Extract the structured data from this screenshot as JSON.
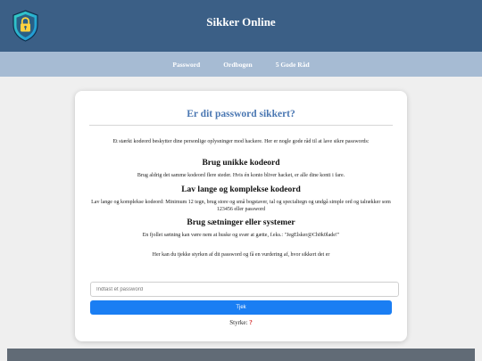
{
  "header": {
    "title": "Sikker Online",
    "logo": "shield-lock-icon"
  },
  "nav": {
    "items": [
      "Password",
      "Ordbogen",
      "5 Gode Råd"
    ]
  },
  "card": {
    "title": "Er dit password sikkert?",
    "intro": "Et stærkt kodeord beskytter dine personlige oplysninger mod hackere. Her er nogle gode råd til at lave sikre passwords:",
    "tips": [
      {
        "heading": "Brug unikke kodeord",
        "text": "Brug aldrig det samme kodeord flere steder. Hvis én konto bliver hacket, er alle dine konti i fare."
      },
      {
        "heading": "Lav lange og komplekse kodeord",
        "text": "Lav lange og komplekse kodeord: Minimum 12 tegn, brug store og små bogstaver, tal og specialtegn og undgå simple ord og talrækker som 123456 eller password"
      },
      {
        "heading": "Brug sætninger eller systemer",
        "text": "En fjollet sætning kan være nem at huske og svær at gætte, f.eks.: \"JegElsker@Ch0k0lade!\""
      }
    ],
    "check_text": "Her kan du tjekke styrken af dit password og få en vurdering af, hvor sikkert det er",
    "input_placeholder": "Indtast et password",
    "input_value": "",
    "button_label": "Tjek",
    "strength_label": "Styrke:",
    "strength_value": "?"
  },
  "footer": {
    "text": ""
  },
  "colors": {
    "header": "#3b5f86",
    "nav": "#a6bbd3",
    "title": "#4a77b2",
    "button": "#1a7ef3",
    "strength_value": "#d01818",
    "footer": "#616b76"
  }
}
